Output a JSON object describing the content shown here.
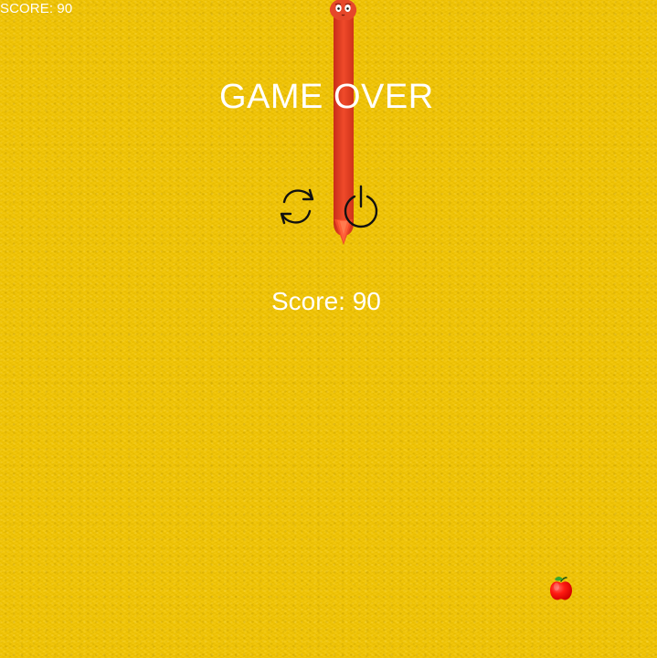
{
  "hud": {
    "score_text": "SCORE: 90"
  },
  "overlay": {
    "title": "GAME OVER",
    "score_text": "Score: 90"
  },
  "icons": {
    "restart": "restart-icon",
    "power": "power-icon",
    "snake": "snake-icon",
    "apple": "apple-icon"
  },
  "colors": {
    "background": "#f2c400",
    "text": "#ffffff",
    "snake": "#e53a21",
    "apple": "#ff1a12",
    "leaf": "#34a02d",
    "icon": "#111111"
  }
}
